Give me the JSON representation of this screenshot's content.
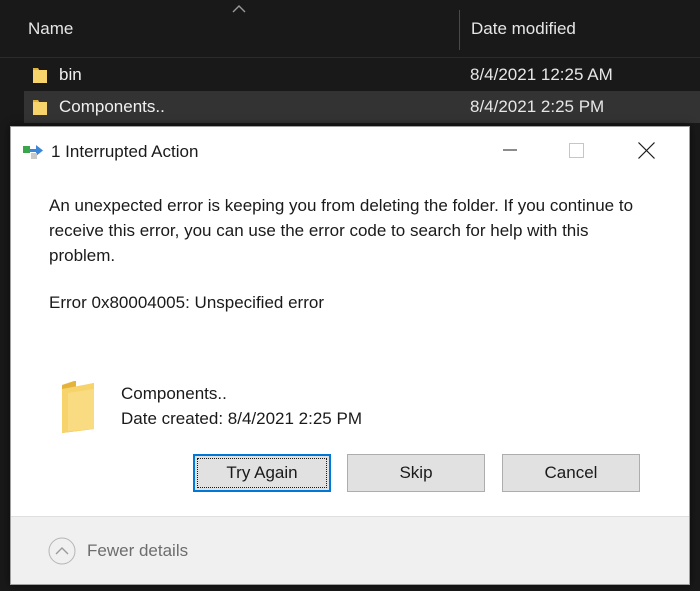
{
  "explorer": {
    "columns": {
      "name": "Name",
      "date_modified": "Date modified"
    },
    "rows": [
      {
        "name": "bin",
        "date": "8/4/2021 12:25 AM",
        "icon": "folder-icon",
        "selected": false
      },
      {
        "name": "Components..",
        "date": "8/4/2021 2:25 PM",
        "icon": "folder-icon",
        "selected": true
      }
    ]
  },
  "dialog": {
    "title": "1 Interrupted Action",
    "message": "An unexpected error is keeping you from deleting the folder. If you continue to receive this error, you can use the error code to search for help with this problem.",
    "error_code": "Error 0x80004005: Unspecified error",
    "item": {
      "name": "Components..",
      "created": "Date created: 8/4/2021 2:25 PM",
      "icon": "folder-icon"
    },
    "buttons": {
      "try_again": "Try Again",
      "skip": "Skip",
      "cancel": "Cancel"
    },
    "footer": {
      "fewer_details": "Fewer details"
    }
  },
  "colors": {
    "explorer_bg": "#191919",
    "selected_row": "#333333",
    "folder": "#f7d36b",
    "dialog_bg": "#ffffff",
    "footer_bg": "#f0f0f0",
    "accent": "#0078d7"
  }
}
